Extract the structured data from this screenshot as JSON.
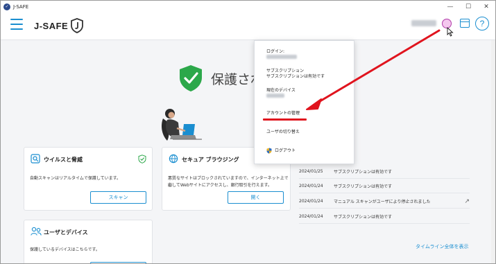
{
  "window": {
    "title": "J-SAFE",
    "controls": [
      "—",
      "☐",
      "✕"
    ]
  },
  "header": {
    "logo_text": "J-SAFE",
    "help_label": "?"
  },
  "status": {
    "text": "保護され"
  },
  "menu": {
    "login_label": "ログイン:",
    "subscription_line1": "サブスクリプション",
    "subscription_line2": "サブスクリプションは有効です",
    "device_label": "現在のデバイス",
    "account_label": "アカウントの管理",
    "switch_user_label": "ユーザの切り替え",
    "logout_label": "ログアウト"
  },
  "cards": {
    "virus": {
      "title": "ウイルスと脅威",
      "desc": "自動スキャンはリアルタイムで保護しています。",
      "button": "スキャン"
    },
    "browsing": {
      "title": "セキュア ブラウジング",
      "desc_line1": "悪質なサイトはブロックされていますので、インターネット上で安",
      "desc_line2": "心してWebサイトにアクセスし、銀行取引を行えます。",
      "button": "開く"
    },
    "users": {
      "title": "ユーザとデバイス",
      "desc": "保護しているデバイスはこちらです。"
    }
  },
  "timeline": {
    "rows": [
      {
        "date": "2024/01/25",
        "text": "サブスクリプションは有効です"
      },
      {
        "date": "2024/01/24",
        "text": "サブスクリプションは有効です"
      },
      {
        "date": "2024/01/24",
        "text": "マニュアル スキャンがユーザにより停止されました"
      },
      {
        "date": "2024/01/24",
        "text": "サブスクリプションは有効です"
      }
    ],
    "ext_icon": "↗",
    "show_all": "タイムライン全体を表示"
  },
  "colors": {
    "accent": "#1a8ed0",
    "ok_green": "#2ca84a",
    "annotation_red": "#e0141e"
  }
}
